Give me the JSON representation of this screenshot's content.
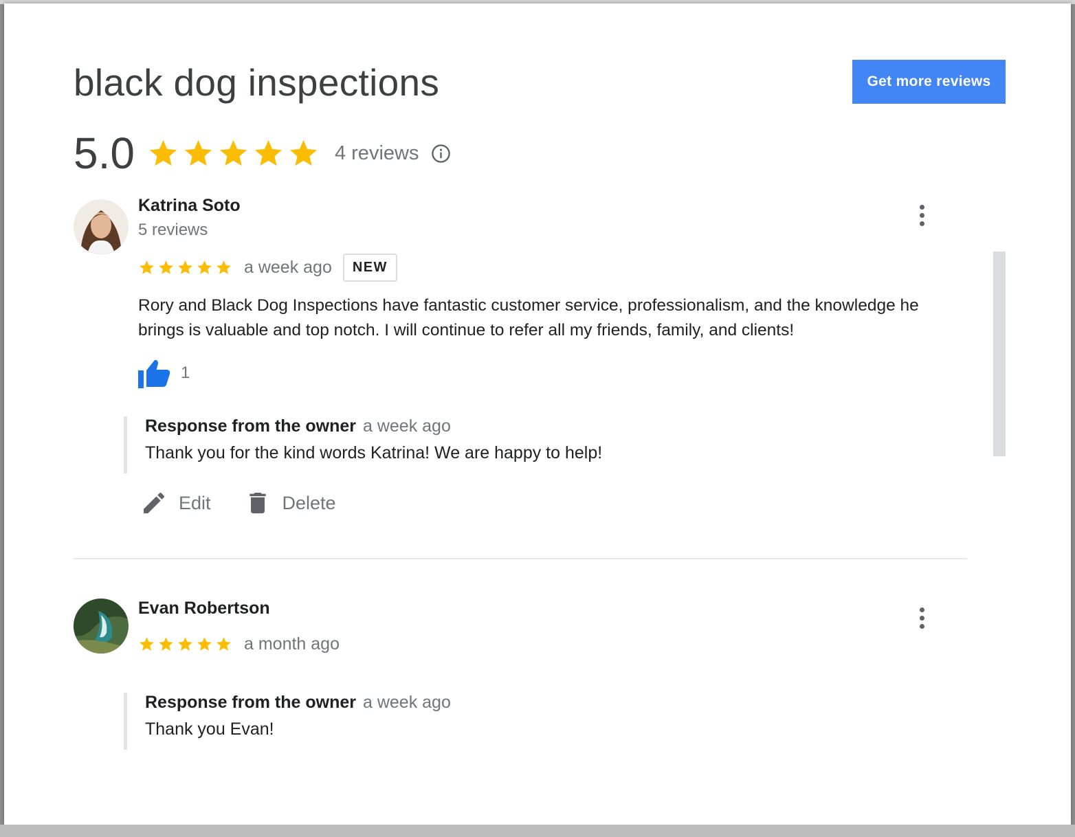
{
  "business": {
    "title": "black dog inspections",
    "cta_label": "Get more reviews",
    "rating": "5.0",
    "stars": 5,
    "review_count": "4 reviews",
    "info_icon": "info-icon"
  },
  "reviews": [
    {
      "name": "Katrina Soto",
      "reviews_count": "5 reviews",
      "stars": 5,
      "time": "a week ago",
      "badge": "NEW",
      "text": "Rory and Black Dog Inspections have fantastic customer service, professionalism, and the knowledge he brings is valuable and top notch. I will continue to refer all my friends, family, and clients!",
      "likes": "1",
      "owner_response": {
        "label": "Response from the owner",
        "time": "a week ago",
        "text": "Thank you for the kind words Katrina! We are happy to help!"
      },
      "actions": {
        "edit": "Edit",
        "delete": "Delete"
      }
    },
    {
      "name": "Evan Robertson",
      "stars": 5,
      "time": "a month ago",
      "owner_response": {
        "label": "Response from the owner",
        "time": "a week ago",
        "text": "Thank you Evan!"
      }
    }
  ],
  "colors": {
    "star": "#fbbc04",
    "accent": "#4285f4",
    "like": "#1a73e8",
    "muted": "#70757a"
  }
}
